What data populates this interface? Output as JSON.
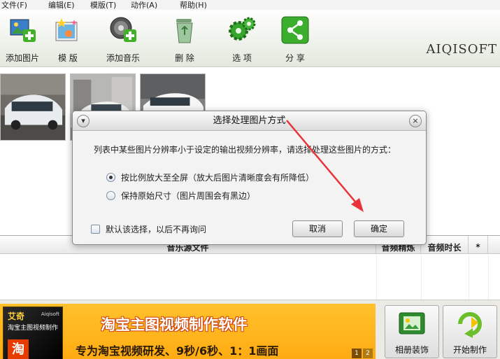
{
  "menu": [
    "文件(F)",
    "编辑(E)",
    "模版(T)",
    "动作(A)",
    "帮助(H)"
  ],
  "toolbar": {
    "add_image": "添加图片",
    "template": "模 版",
    "add_music": "添加音乐",
    "delete": "删 除",
    "options": "选 项",
    "share": "分 享",
    "brand": "AIQISOFT"
  },
  "music_table": {
    "col_file": "音乐源文件",
    "col_clip": "音频精炼",
    "col_duration": "音频时长",
    "col_star": "*"
  },
  "banner": {
    "box_title": "艾奇",
    "box_line2": "淘宝主图视频制作",
    "box_brand": "Aiqisoft",
    "box_tao": "淘",
    "headline": "淘宝主图视频制作软件",
    "subline": "专为淘宝视频研发、9秒/6秒、1：1画面",
    "pages": [
      "1",
      "2"
    ]
  },
  "buttons": {
    "album": "相册装饰",
    "start": "开始制作"
  },
  "dialog": {
    "title": "选择处理图片方式",
    "message": "列表中某些图片分辨率小于设定的输出视频分辨率，请选择处理这些图片的方式：",
    "option1": "按比例放大至全屏（放大后图片清晰度会有所降低）",
    "option2": "保持原始尺寸（图片周围会有黑边）",
    "remember": "默认该选择，以后不再询问",
    "cancel": "取消",
    "ok": "确定",
    "menu_glyph": "▾",
    "close_glyph": "×"
  },
  "colors": {
    "accent_arrow": "#e8333a",
    "banner_orange": "#ffb31e"
  }
}
